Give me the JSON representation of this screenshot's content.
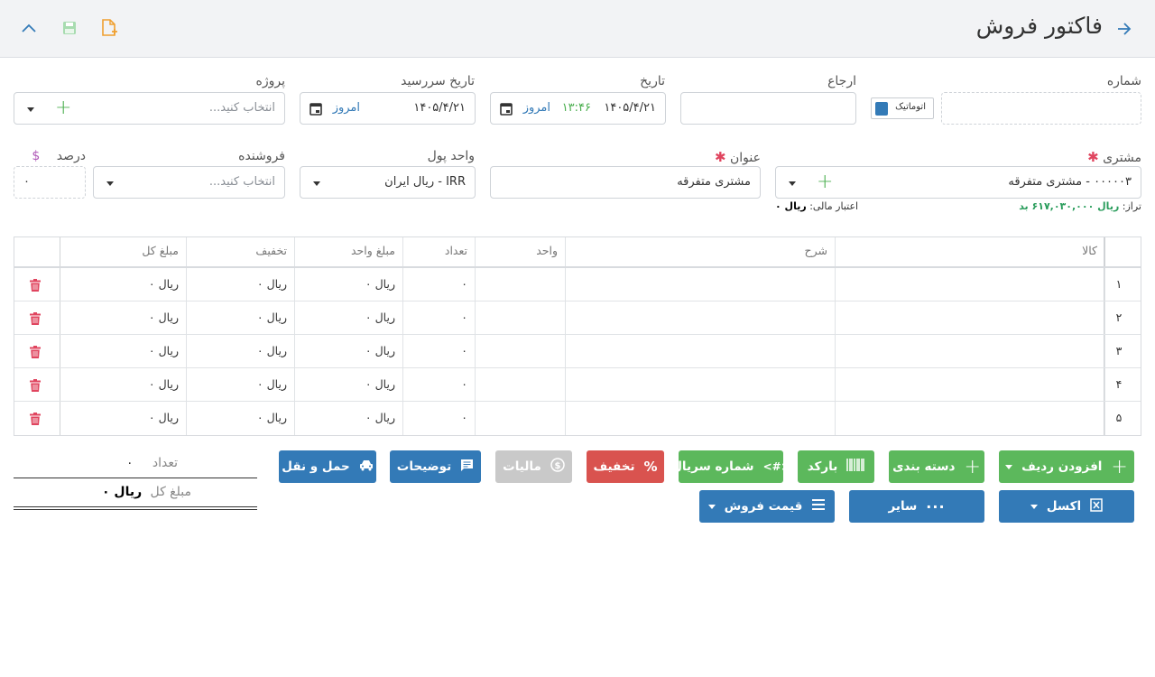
{
  "header": {
    "title": "فاکتور فروش",
    "icons": [
      "arrow-right-icon",
      "add-document-icon",
      "save-icon",
      "chevron-up-icon"
    ],
    "colors": {
      "accent": "#337ab7",
      "orange": "#f0a030",
      "save_green": "#8fd19e"
    }
  },
  "form": {
    "number": {
      "label": "شماره",
      "value": ""
    },
    "auto": {
      "label": "اتوماتیک",
      "checked": true
    },
    "reference": {
      "label": "ارجاع",
      "value": ""
    },
    "date": {
      "label": "تاریخ",
      "value": "۱۴۰۵/۴/۲۱",
      "time": "۱۳:۴۶",
      "today": "امروز"
    },
    "due_date": {
      "label": "تاریخ سررسید",
      "value": "۱۴۰۵/۴/۲۱",
      "today": "امروز"
    },
    "project": {
      "label": "پروژه",
      "placeholder": "انتخاب کنید..."
    },
    "customer": {
      "label": "مشتری",
      "value": "۰۰۰۰۰۳ - مشتری متفرقه",
      "balance_label": "تراز:",
      "balance_value": "ریال ۶۱۷,۰۳۰,۰۰۰ بد",
      "credit_label": "اعتبار مالی:",
      "credit_value": "ریال ۰"
    },
    "title_field": {
      "label": "عنوان",
      "value": "مشتری متفرقه"
    },
    "currency": {
      "label": "واحد پول",
      "value": "IRR - ریال ایران"
    },
    "seller": {
      "label": "فروشنده",
      "placeholder": "انتخاب کنید..."
    },
    "percent": {
      "label": "درصد",
      "symbol": "$",
      "value": "۰"
    }
  },
  "table": {
    "headers": {
      "item": "کالا",
      "desc": "شرح",
      "unit": "واحد",
      "qty": "تعداد",
      "unit_price": "مبلغ واحد",
      "discount": "تخفیف",
      "total": "مبلغ کل"
    },
    "rows": [
      {
        "num": "۱",
        "qty": "۰",
        "unit_price": "ریال ۰",
        "discount": "ریال ۰",
        "total": "ریال ۰"
      },
      {
        "num": "۲",
        "qty": "۰",
        "unit_price": "ریال ۰",
        "discount": "ریال ۰",
        "total": "ریال ۰"
      },
      {
        "num": "۳",
        "qty": "۰",
        "unit_price": "ریال ۰",
        "discount": "ریال ۰",
        "total": "ریال ۰"
      },
      {
        "num": "۴",
        "qty": "۰",
        "unit_price": "ریال ۰",
        "discount": "ریال ۰",
        "total": "ریال ۰"
      },
      {
        "num": "۵",
        "qty": "۰",
        "unit_price": "ریال ۰",
        "discount": "ریال ۰",
        "total": "ریال ۰"
      }
    ]
  },
  "buttons": {
    "add_row": "افزودن ردیف",
    "category": "دسته بندی",
    "barcode": "بارکد",
    "serial": "شماره سریال",
    "discount": "تخفیف",
    "tax": "مالیات",
    "notes": "توضیحات",
    "shipping": "حمل و نقل",
    "excel": "اکسل",
    "other": "سایر",
    "sale_price": "قیمت فروش"
  },
  "summary": {
    "count_label": "تعداد",
    "count_value": "۰",
    "total_label": "مبلغ کل",
    "total_value": "ریال ۰"
  }
}
